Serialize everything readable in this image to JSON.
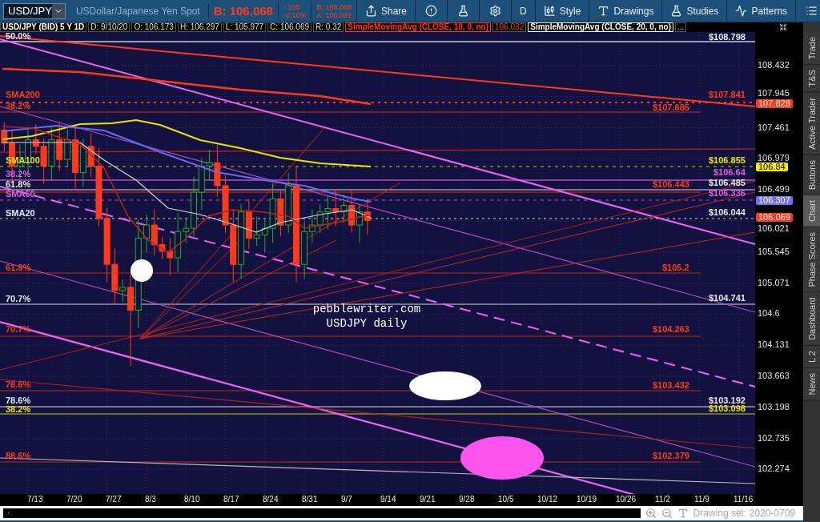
{
  "toolbar": {
    "symbol": "USD/JPY",
    "description": "USDollar/Japanese Yen Spot",
    "bid": "B: 106.068",
    "change": "-.108",
    "change_percent": "-0.10%",
    "bid_small": "B: 106.068",
    "ask": "A: 106.082",
    "buttons": [
      {
        "kind": "share",
        "label": "Share"
      },
      {
        "kind": "alert"
      },
      {
        "kind": "flask"
      },
      {
        "kind": "gear"
      },
      {
        "kind": "aggregation",
        "label": "D"
      },
      {
        "kind": "style",
        "label": "Style"
      },
      {
        "kind": "drawings",
        "label": "Drawings"
      },
      {
        "kind": "studies",
        "label": "Studies"
      },
      {
        "kind": "patterns",
        "label": "Patterns"
      },
      {
        "kind": "menu"
      }
    ]
  },
  "info_bar": {
    "title": "USD/JPY (BID) 5 Y 1D",
    "fields": [
      "D: 9/10/20",
      "O: 106.173",
      "H: 106.297",
      "L: 105.977",
      "C: 106.069",
      "R: 0.32"
    ],
    "studies": [
      {
        "name": "SimpleMovingAvg (CLOSE, 10, 0, no)",
        "value": "106.032",
        "color": "#ff3a1a"
      },
      {
        "name": "SimpleMovingAvg (CLOSE, 20, 0, no)",
        "color": "#ffffff"
      }
    ],
    "more": "..."
  },
  "chart": {
    "left_labels": [
      {
        "text": "50.0%",
        "color": "#e8e8e8"
      },
      {
        "text": "SMA200",
        "color": "#ff3a1a"
      },
      {
        "text": "38.2%",
        "color": "#ff3a1a"
      },
      {
        "text": "SMA100",
        "color": "#e6e600"
      },
      {
        "text": "38.2%",
        "color": "#e060e0"
      },
      {
        "text": "61.8%",
        "color": "#e8e8e8"
      },
      {
        "text": "SMA50",
        "color": "#e060e0"
      },
      {
        "text": "SMA20",
        "color": "#e8e8e8"
      },
      {
        "text": "61.8%",
        "color": "#ff3a1a"
      },
      {
        "text": "70.7%",
        "color": "#e8e8e8"
      },
      {
        "text": "70.7%",
        "color": "#ff3a1a"
      },
      {
        "text": "78.6%",
        "color": "#ff3a1a"
      },
      {
        "text": "78.6%",
        "color": "#e8e8e8"
      },
      {
        "text": "38.2%",
        "color": "#e6e600"
      },
      {
        "text": "88.6%",
        "color": "#ff3a1a"
      }
    ],
    "right_labels": [
      {
        "text": "$108.798",
        "color": "#e8e8e8"
      },
      {
        "text": "$107.841",
        "color": "#ff3a1a"
      },
      {
        "text": "$107.685",
        "color": "#ff3a1a"
      },
      {
        "text": "$106.855",
        "color": "#e6e600"
      },
      {
        "text": "$106.64",
        "color": "#e060e0"
      },
      {
        "text": "$106.443",
        "color": "#ff3a1a"
      },
      {
        "text": "$106.485",
        "color": "#e8e8e8"
      },
      {
        "text": "$106.336",
        "color": "#e060e0"
      },
      {
        "text": "$106.044",
        "color": "#e8e8e8"
      },
      {
        "text": "$105.2",
        "color": "#ff3a1a"
      },
      {
        "text": "$104.741",
        "color": "#e8e8e8"
      },
      {
        "text": "$104.263",
        "color": "#ff3a1a"
      },
      {
        "text": "$103.432",
        "color": "#ff3a1a"
      },
      {
        "text": "$103.192",
        "color": "#e8e8e8"
      },
      {
        "text": "$103.098",
        "color": "#e6e600"
      },
      {
        "text": "$102.379",
        "color": "#ff3a1a"
      }
    ],
    "note": [
      "pebblewriter.com",
      "USDJPY daily"
    ],
    "price_axis": [
      "108.432",
      "107.945",
      "107.461",
      "106.979",
      "106.499",
      "106.021",
      "105.545",
      "105.071",
      "104.6",
      "104.131",
      "103.663",
      "103.198",
      "102.735",
      "102.274"
    ],
    "price_badges": [
      {
        "text": "107.828",
        "color": "#ff3a1a"
      },
      {
        "text": "106.84",
        "color": "#f0f000"
      },
      {
        "text": "106.307",
        "color": "#6f6ff0"
      },
      {
        "text": "106.069",
        "color": "#ff3a1a"
      }
    ],
    "date_axis": [
      "7/13",
      "7/20",
      "7/27",
      "8/3",
      "8/10",
      "8/17",
      "8/24",
      "8/31",
      "9/7",
      "9/14",
      "9/21",
      "9/28",
      "10/5",
      "10/12",
      "10/19",
      "10/26",
      "11/2",
      "11/9",
      "11/16"
    ]
  },
  "side_tabs": [
    {
      "label": "Trade",
      "selected": false
    },
    {
      "label": "T&S",
      "selected": false
    },
    {
      "label": "Active Trader",
      "selected": false
    },
    {
      "label": "Buttons",
      "selected": false
    },
    {
      "label": "Chart",
      "selected": true
    },
    {
      "label": "Phase Scores",
      "selected": false
    },
    {
      "label": "Dashboard",
      "selected": false
    },
    {
      "label": "L 2",
      "selected": false
    },
    {
      "label": "News",
      "selected": false
    }
  ],
  "footer": {
    "drawing_set": "Drawing set: 2020-0709"
  }
}
